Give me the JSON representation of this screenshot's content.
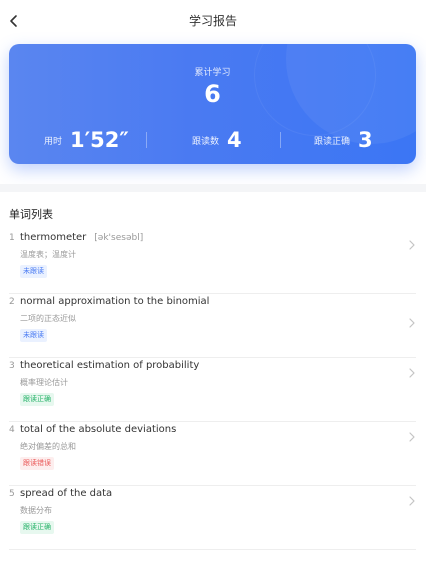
{
  "header": {
    "title": "学习报告"
  },
  "summary": {
    "total_label": "累计学习",
    "total_value": "6",
    "time_label": "用时",
    "time_value": "1′52″",
    "follow_label": "跟读数",
    "follow_value": "4",
    "correct_label": "跟读正确",
    "correct_value": "3"
  },
  "list": {
    "title": "单词列表",
    "items": [
      {
        "index": "1",
        "word": "thermometer",
        "phonetic": "[ək'sesəbl]",
        "meaning": "温度表；温度计",
        "status": "未跟读",
        "status_color": "#4b7cf3"
      },
      {
        "index": "2",
        "word": "normal approximation to the binomial",
        "phonetic": "",
        "meaning": "二项的正态近似",
        "status": "未跟读",
        "status_color": "#4b7cf3"
      },
      {
        "index": "3",
        "word": "theoretical estimation of probability",
        "phonetic": "",
        "meaning": "概率理论估计",
        "status": "跟读正确",
        "status_color": "#28b36a"
      },
      {
        "index": "4",
        "word": "total of the absolute deviations",
        "phonetic": "",
        "meaning": "绝对偏差的总和",
        "status": "跟读错误",
        "status_color": "#ea5a5a"
      },
      {
        "index": "5",
        "word": "spread of the data",
        "phonetic": "",
        "meaning": "数据分布",
        "status": "跟读正确",
        "status_color": "#28b36a"
      }
    ]
  },
  "icons": {
    "back": "chevron-left-icon",
    "row": "chevron-right-icon"
  },
  "colors": {
    "accent": "#4a7af2"
  }
}
